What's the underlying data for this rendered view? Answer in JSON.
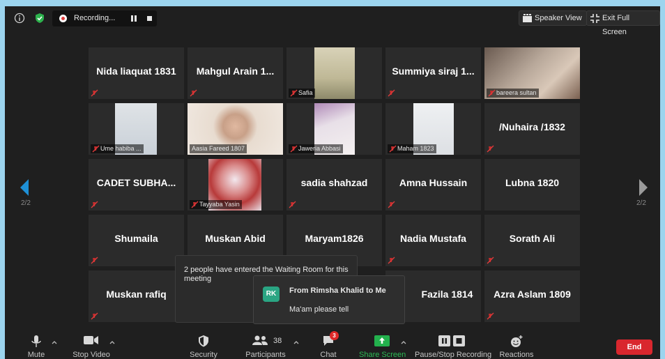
{
  "topbar": {
    "recording_label": "Recording...",
    "speaker_view": "Speaker View",
    "exit_full_screen": "Exit Full Screen"
  },
  "nav": {
    "left_page": "2/2",
    "right_page": "2/2"
  },
  "tiles": {
    "t00": "Nida liaquat 1831",
    "t01": "Mahgul Arain 1...",
    "t02": "Safia",
    "t03": "Summiya siraj 1...",
    "t04": "bareera sultan",
    "t10": "Ume habiba ...",
    "t11": "Aasia Fareed 1807",
    "t12": "Jaweria Abbasi",
    "t13": "Maham 1823",
    "t14": "/Nuhaira /1832",
    "t20": "CADET SUBHA...",
    "t21": "Tayyaba Yasin",
    "t22": "sadia shahzad",
    "t23": "Amna Hussain",
    "t24": "Lubna 1820",
    "t30": "Shumaila",
    "t31": "Muskan Abid",
    "t32": "Maryam1826",
    "t33": "Nadia Mustafa",
    "t34": "Sorath Ali",
    "t40": "Muskan rafiq",
    "t43": "Fazila 1814",
    "t44": "Azra Aslam 1809"
  },
  "waiting": {
    "text": "2 people have entered the Waiting Room for this meeting"
  },
  "chat_popup": {
    "initials": "RK",
    "from": "From Rimsha Khalid to Me",
    "message": "Ma'am please tell"
  },
  "toolbar": {
    "mute": "Mute",
    "stop_video": "Stop Video",
    "security": "Security",
    "participants": "Participants",
    "participants_count": "38",
    "chat": "Chat",
    "chat_badge": "3",
    "share_screen": "Share Screen",
    "pause_stop_recording": "Pause/Stop Recording",
    "reactions": "Reactions",
    "end": "End"
  },
  "colors": {
    "background": "#9cd4ee",
    "window": "#1f1f1f",
    "tile": "#2b2b2b",
    "share_green": "#23b14d",
    "end_red": "#d9272e",
    "nav_arrow": "#1e90d6"
  }
}
